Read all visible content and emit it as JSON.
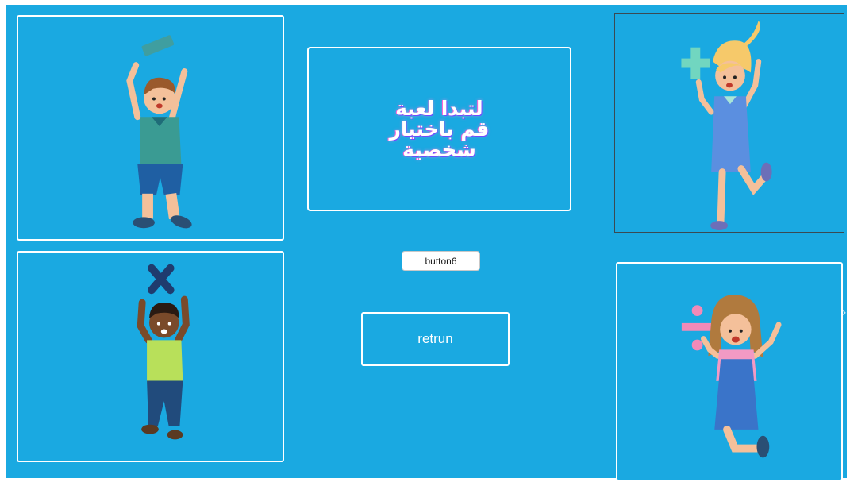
{
  "title_box": {
    "lines": [
      "لتبدا لعبة",
      "قم باختيار",
      "شخصية"
    ]
  },
  "buttons": {
    "button6_label": "button6",
    "return_label": "retrun"
  },
  "characters": [
    {
      "id": "boy-minus",
      "symbol": "minus-icon"
    },
    {
      "id": "girl-plus",
      "symbol": "plus-icon"
    },
    {
      "id": "boy-multiply",
      "symbol": "multiply-icon"
    },
    {
      "id": "girl-divide",
      "symbol": "divide-icon"
    }
  ],
  "colors": {
    "background": "#1aa9e1",
    "border": "#ffffff",
    "title_glow": "#ff5fd6"
  }
}
